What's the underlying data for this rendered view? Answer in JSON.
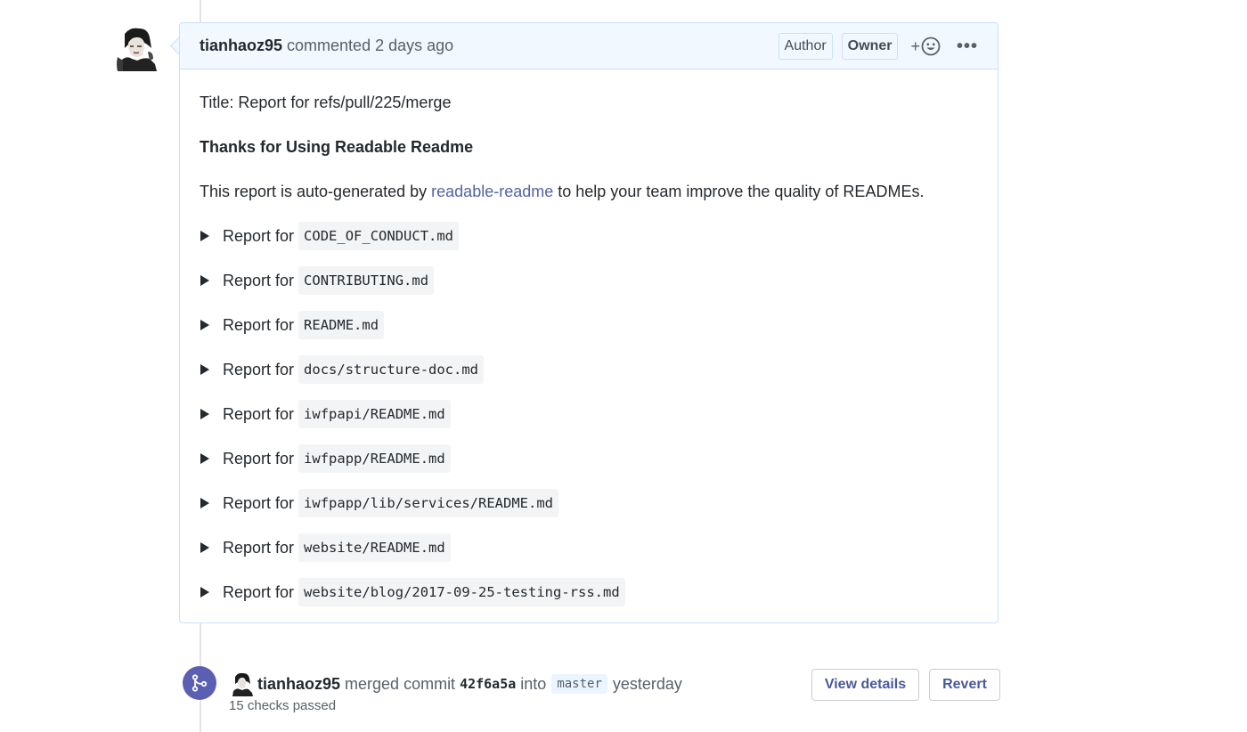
{
  "comment": {
    "author": "tianhaoz95",
    "meta": "commented 2 days ago",
    "badges": [
      "Author",
      "Owner"
    ],
    "reaction_plus": "+",
    "more_label": "•••",
    "title_line": "Title: Report for refs/pull/225/merge",
    "heading": "Thanks for Using Readable Readme",
    "intro_prefix": "This report is auto-generated by",
    "intro_link": "readable-readme",
    "intro_suffix": "to help your team improve the quality of READMEs.",
    "report_prefix": "Report for",
    "reports": [
      "CODE_OF_CONDUCT.md",
      "CONTRIBUTING.md",
      "README.md",
      "docs/structure-doc.md",
      "iwfpapi/README.md",
      "iwfpapp/README.md",
      "iwfpapp/lib/services/README.md",
      "website/README.md",
      "website/blog/2017-09-25-testing-rss.md"
    ]
  },
  "merge_event": {
    "author": "tianhaoz95",
    "action": "merged commit",
    "commit": "42f6a5a",
    "into": "into",
    "branch": "master",
    "when": "yesterday",
    "checks": "15 checks passed",
    "view_details": "View details",
    "revert": "Revert"
  },
  "colors": {
    "header_bg": "#f1f8ff",
    "border": "#c8e1ff",
    "link": "#5163a6",
    "merge_icon": "#5b5fb4"
  }
}
